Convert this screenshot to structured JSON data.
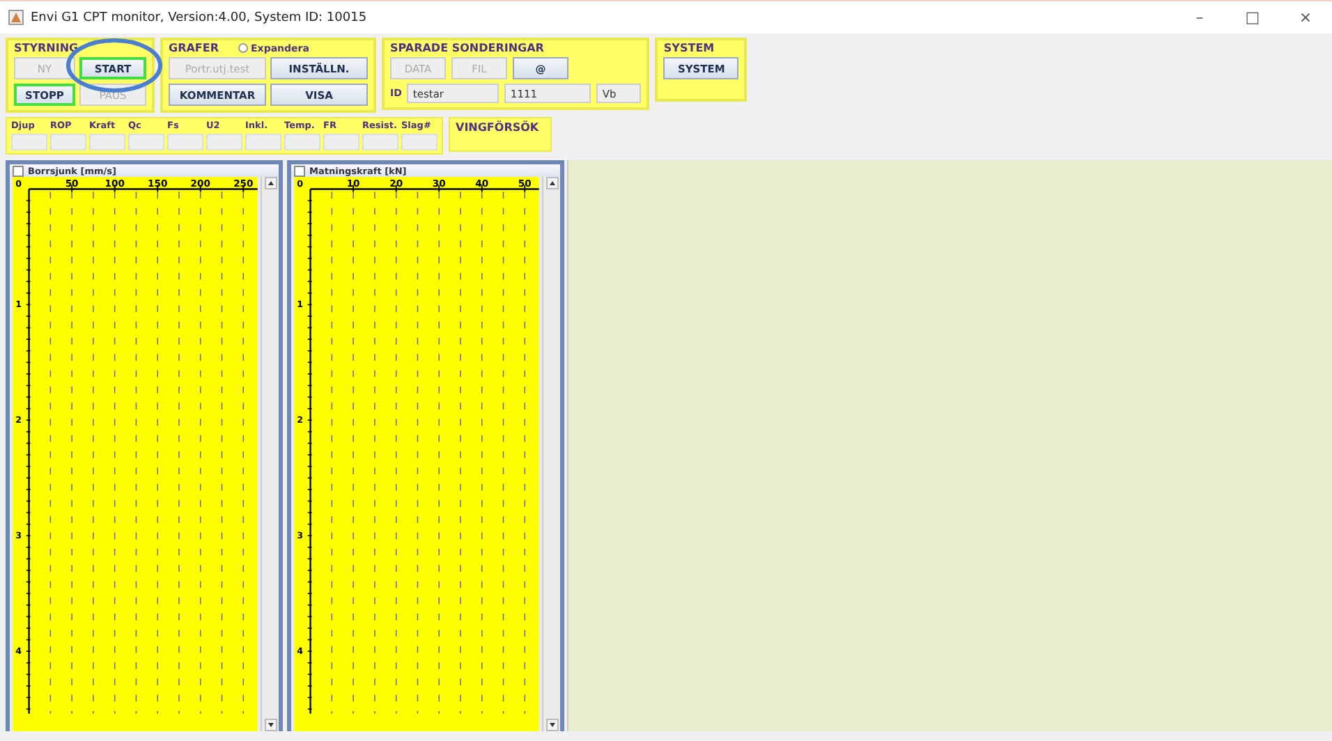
{
  "window": {
    "title": "Envi G1 CPT monitor,   Version:4.00, System ID: 10015",
    "controls": [
      "–",
      "□",
      "×"
    ]
  },
  "groups": [
    {
      "title": "STYRNING",
      "kind": "grid",
      "buttons": [
        {
          "label": "NY",
          "disabled": true,
          "focused": false
        },
        {
          "label": "START",
          "disabled": false,
          "focused": true
        },
        {
          "label": "STOPP",
          "disabled": false,
          "focused": true
        },
        {
          "label": "PAUS",
          "disabled": true,
          "focused": false
        }
      ]
    },
    {
      "title": "GRAFER",
      "kind": "grid",
      "radio": {
        "label": "Expandera",
        "checked": false
      },
      "buttons": [
        {
          "label": "Portr.utj.test",
          "disabled": true,
          "focused": false
        },
        {
          "label": "INSTÄLLN.",
          "disabled": false,
          "focused": false
        },
        {
          "label": "KOMMENTAR",
          "disabled": false,
          "focused": false
        },
        {
          "label": "VISA",
          "disabled": false,
          "focused": false
        }
      ]
    },
    {
      "title": "SPARADE SONDERINGAR",
      "kind": "saved",
      "buttons": [
        {
          "label": "DATA",
          "disabled": true,
          "focused": false
        },
        {
          "label": "FIL",
          "disabled": true,
          "focused": false
        },
        {
          "label": "@",
          "disabled": false,
          "focused": false
        }
      ],
      "id_label": "ID",
      "fields": [
        "testar",
        "1111",
        "Vb"
      ]
    },
    {
      "title": "SYSTEM",
      "kind": "single",
      "buttons": [
        {
          "label": "SYSTEM",
          "disabled": false,
          "focused": false
        }
      ]
    }
  ],
  "readings": [
    "Djup",
    "ROP",
    "Kraft",
    "Qc",
    "Fs",
    "U2",
    "Inkl.",
    "Temp.",
    "FR",
    "Resist.",
    "Slag#"
  ],
  "vane_test": {
    "title": "VINGFÖRSÖK"
  },
  "annotation": {
    "kind": "ellipse"
  },
  "charts": [
    {
      "title": "Borrsjunk [mm/s]",
      "checked": false,
      "chart_data": {
        "type": "line",
        "xlim": [
          0,
          265
        ],
        "ylim": [
          4.54,
          0
        ],
        "grid": true,
        "xticks": [
          50,
          100,
          150,
          200,
          250
        ],
        "yticks": [
          0,
          1,
          2,
          3,
          4
        ]
      }
    },
    {
      "title": "Matningskraft [kN]",
      "checked": false,
      "chart_data": {
        "type": "line",
        "xlim": [
          0,
          53
        ],
        "ylim": [
          4.54,
          0
        ],
        "grid": true,
        "xticks": [
          10,
          20,
          30,
          40,
          50
        ],
        "yticks": [
          0,
          1,
          2,
          3,
          4
        ]
      }
    }
  ]
}
